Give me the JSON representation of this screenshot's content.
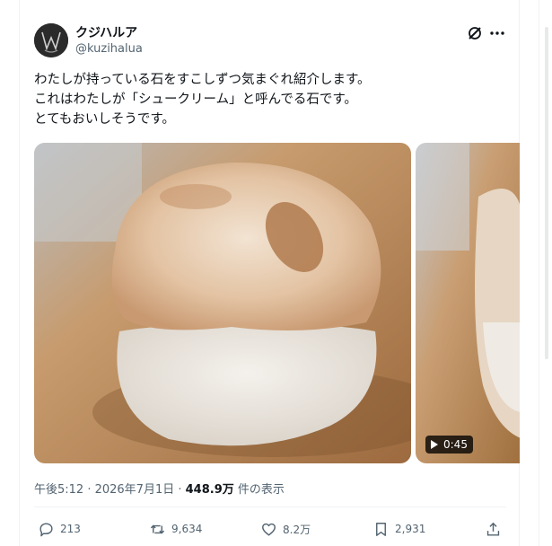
{
  "author": {
    "display_name": "クジハルア",
    "handle": "@kuzihalua"
  },
  "post": {
    "lines": [
      "わたしが持っている石をすこしずつ気まぐれ紹介します。",
      "これはわたしが「シュークリーム」と呼んでる石です。",
      "とてもおいしそうです。"
    ]
  },
  "media": {
    "video_duration": "0:45"
  },
  "meta": {
    "timestamp": "午後5:12 · 2026年7月1日 · ",
    "views_count": "448.9万",
    "views_label": " 件の表示"
  },
  "actions": {
    "replies": "213",
    "reposts": "9,634",
    "likes": "8.2万",
    "bookmarks": "2,931"
  },
  "icons": {
    "header": [
      "grok-icon",
      "more-icon"
    ],
    "actions": [
      "reply-icon",
      "repost-icon",
      "like-icon",
      "bookmark-icon",
      "share-icon"
    ]
  },
  "colors": {
    "text": "#0f1419",
    "secondary": "#536471",
    "divider": "#eff3f4"
  }
}
